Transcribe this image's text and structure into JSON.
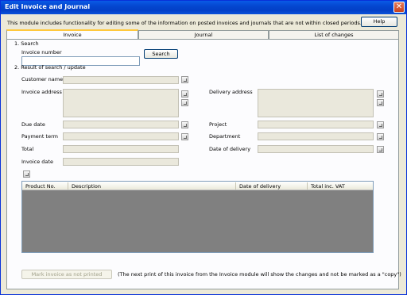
{
  "window": {
    "title": "Edit Invoice and Journal"
  },
  "description": "This module includes functionality for editing some of the information on posted invoices and journals that are not within closed periods.",
  "help_label": "Help",
  "tabs": [
    {
      "label": "Invoice"
    },
    {
      "label": "Journal"
    },
    {
      "label": "List of changes"
    }
  ],
  "search": {
    "section_label": "1. Search",
    "invoice_number_label": "Invoice number",
    "invoice_number_value": "",
    "button_label": "Search"
  },
  "result": {
    "section_label": "2. Result of search / update",
    "customer_name_label": "Customer name",
    "invoice_address_label": "Invoice address",
    "delivery_address_label": "Delivery address",
    "due_date_label": "Due date",
    "payment_term_label": "Payment term",
    "total_label": "Total",
    "invoice_date_label": "Invoice date",
    "project_label": "Project",
    "department_label": "Department",
    "date_of_delivery_label": "Date of delivery"
  },
  "grid": {
    "columns": [
      "Product No.",
      "Description",
      "Date of delivery",
      "Total inc. VAT"
    ]
  },
  "footer": {
    "mark_button_label": "Mark invoice as not printed",
    "note": "(The next print of this invoice from the Invoice module will show the changes and not be marked as a \"copy\")"
  },
  "colors": {
    "titlebar": "#0446cf",
    "active_tab_accent": "#ffc83c",
    "grid_background": "#808080"
  }
}
